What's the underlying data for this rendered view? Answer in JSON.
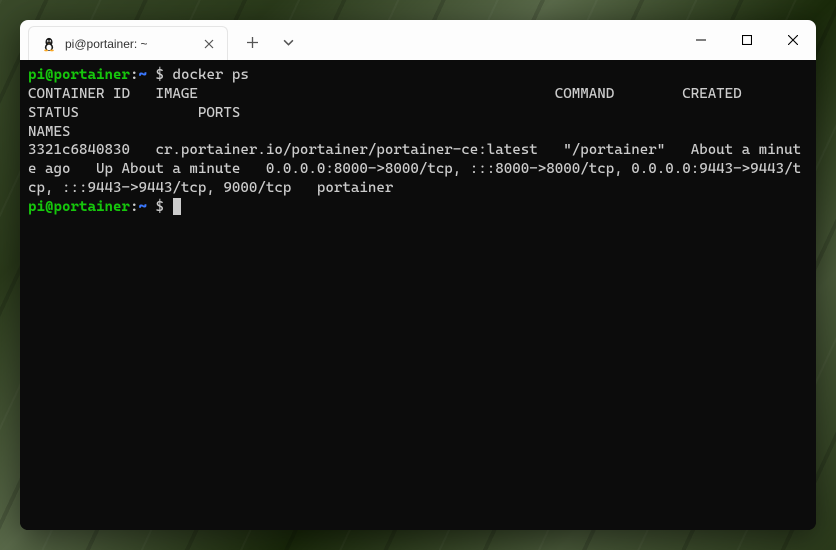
{
  "tab": {
    "title": "pi@portainer: ~"
  },
  "prompt": {
    "user_host": "pi@portainer",
    "colon": ":",
    "path": "~",
    "symbol": " $ "
  },
  "cmd1": "docker ps",
  "output_header": "CONTAINER ID   IMAGE                                          COMMAND        CREATED              STATUS              PORTS                                                                                  NAMES",
  "output_row": "3321c6840830   cr.portainer.io/portainer/portainer-ce:latest   \"/portainer\"   About a minute ago   Up About a minute   0.0.0.0:8000->8000/tcp, :::8000->8000/tcp, 0.0.0.0:9443->9443/tcp, :::9443->9443/tcp, 9000/tcp   portainer"
}
